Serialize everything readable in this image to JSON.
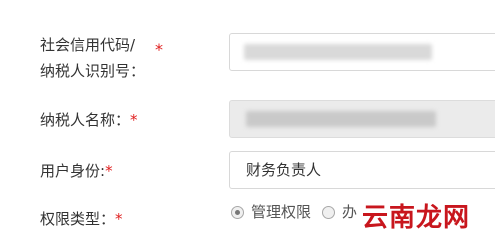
{
  "form": {
    "credit_code": {
      "label_line1": "社会信用代码/",
      "label_line2": "纳税人识别号：",
      "required_mark": "*"
    },
    "taxpayer_name": {
      "label": "纳税人名称：",
      "required_mark": "*"
    },
    "user_role": {
      "label": "用户身份:",
      "required_mark": "*",
      "value": "财务负责人"
    },
    "permission_type": {
      "label": "权限类型：",
      "required_mark": "*",
      "options": [
        {
          "label": "管理权限",
          "checked": true
        },
        {
          "label": "办",
          "checked": false
        }
      ]
    }
  },
  "watermark": {
    "text": "云南龙网",
    "color": "#c8161d"
  }
}
